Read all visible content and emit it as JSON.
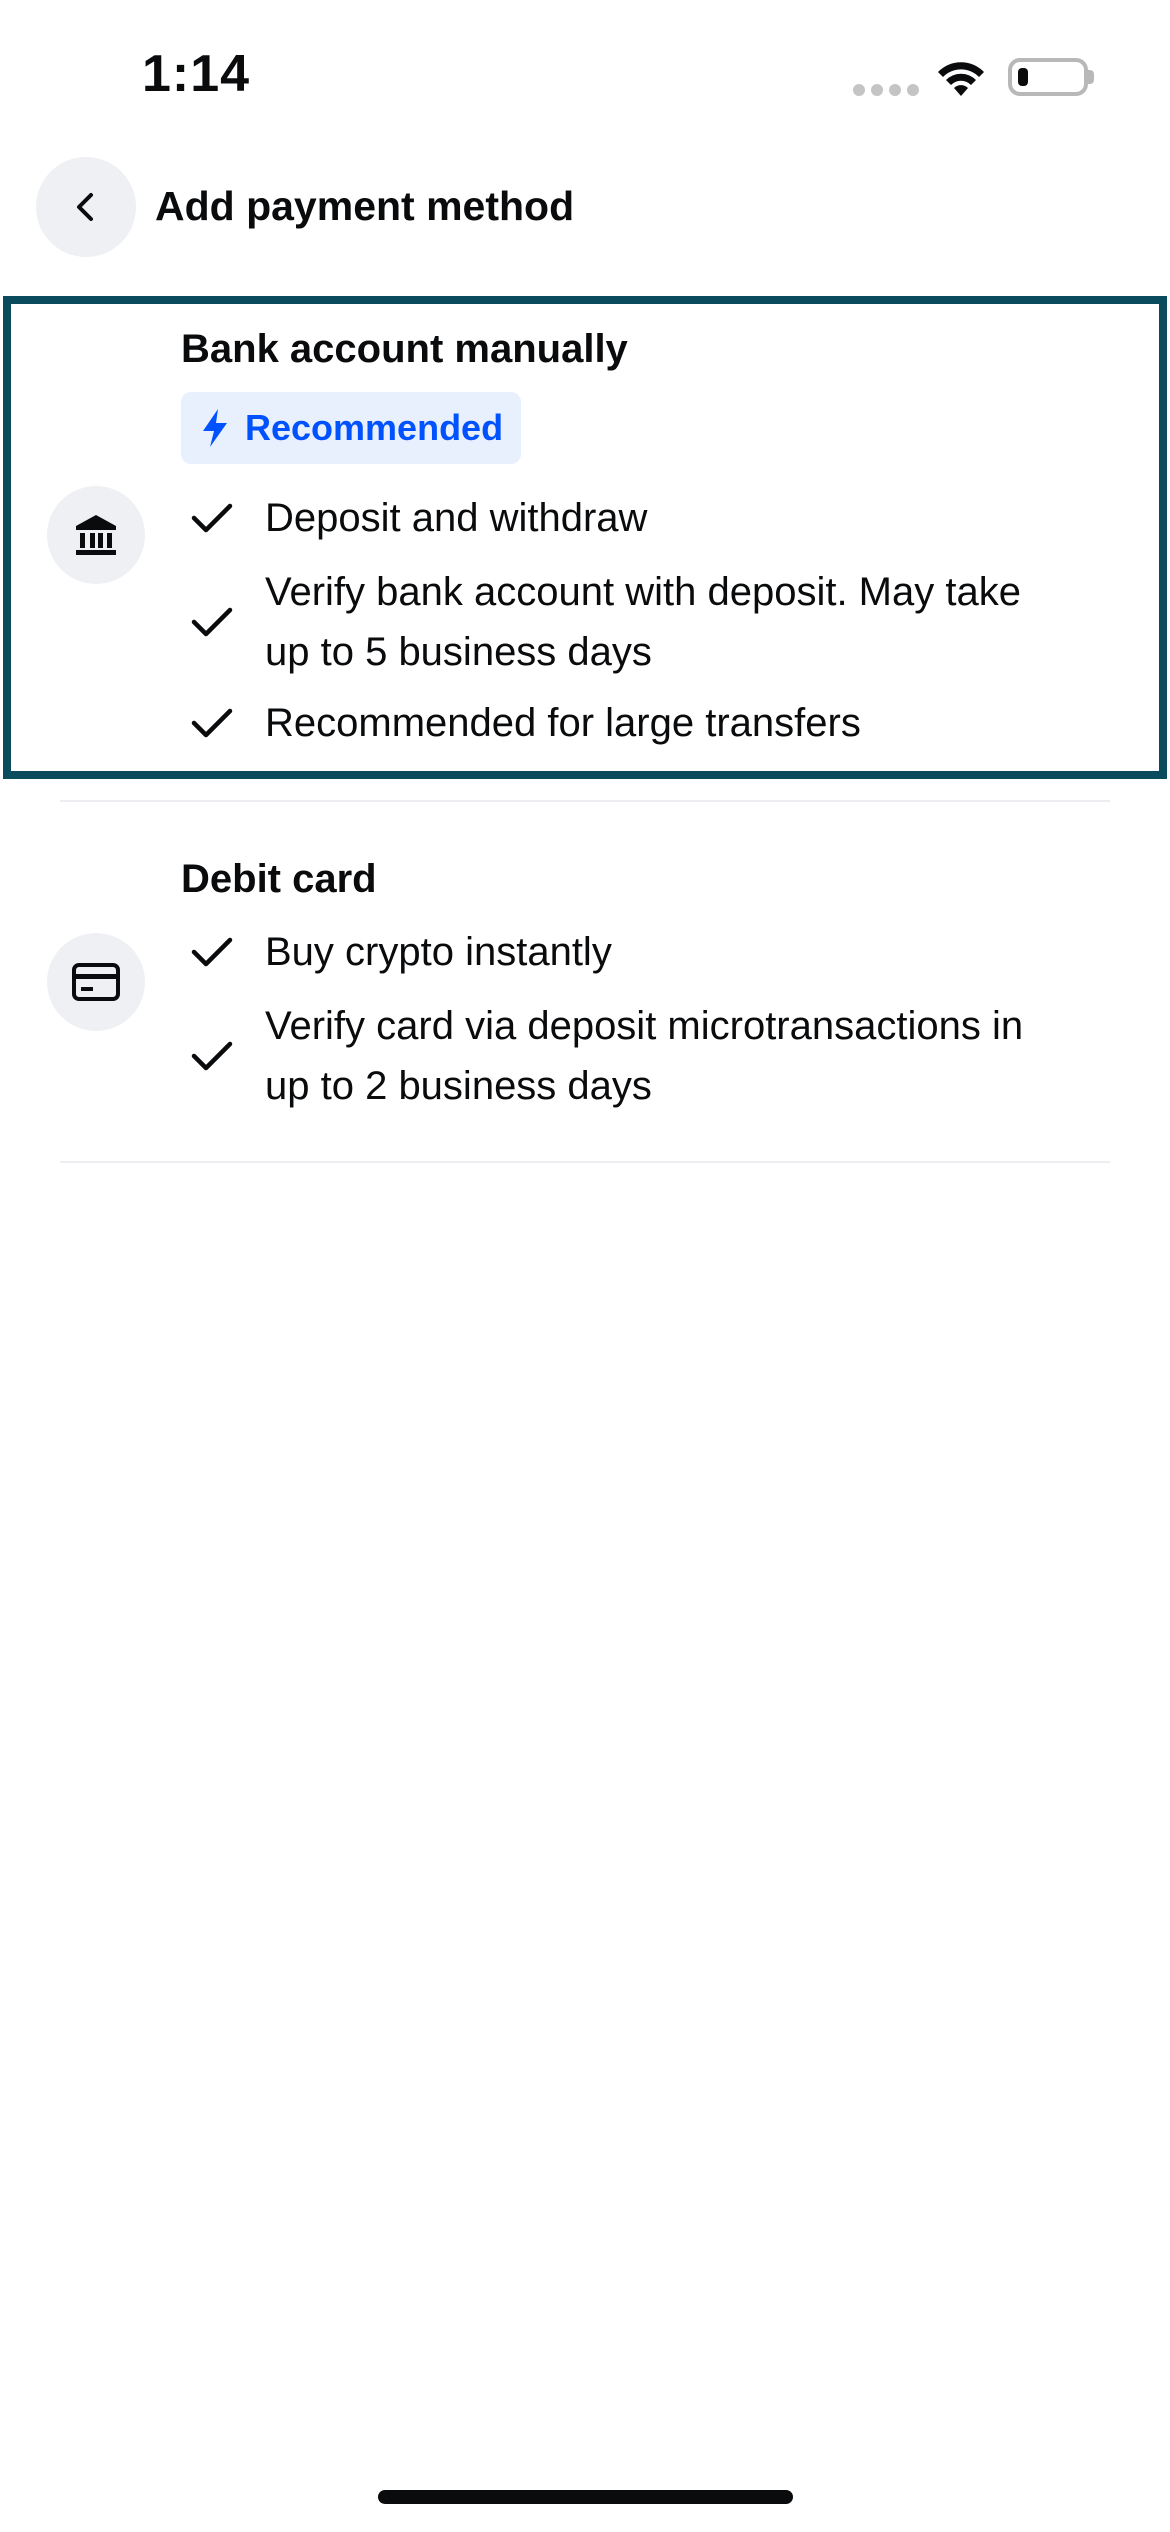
{
  "status_bar": {
    "time": "1:14"
  },
  "header": {
    "title": "Add payment method",
    "back_icon": "chevron-left-icon"
  },
  "options": [
    {
      "title": "Bank account manually",
      "icon": "bank-icon",
      "badge": {
        "label": "Recommended",
        "icon": "lightning-icon",
        "color": "#0052ff",
        "background": "#e8f0fd"
      },
      "features": [
        "Deposit and withdraw",
        "Verify bank account with deposit. May take up to 5 business days",
        "Recommended for large transfers"
      ],
      "selected": true,
      "highlight_color": "#0b4b5e"
    },
    {
      "title": "Debit card",
      "icon": "credit-card-icon",
      "features": [
        "Buy crypto instantly",
        "Verify card via deposit microtransactions in up to 2 business days"
      ],
      "selected": false
    }
  ]
}
